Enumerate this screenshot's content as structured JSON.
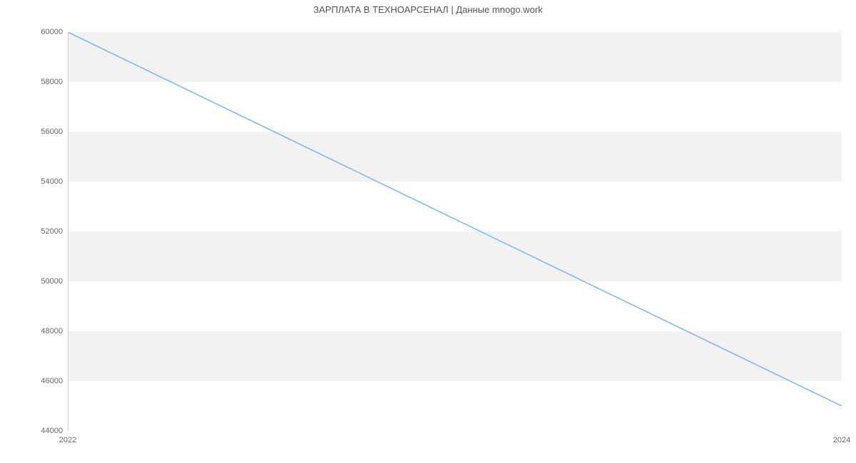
{
  "chart_data": {
    "type": "line",
    "title": "ЗАРПЛАТА В ТЕХНОАРСЕНАЛ | Данные mnogo.work",
    "xlabel": "",
    "ylabel": "",
    "x": [
      2022,
      2024
    ],
    "values": [
      60000,
      45000
    ],
    "x_ticks": [
      2022,
      2024
    ],
    "y_ticks": [
      44000,
      46000,
      48000,
      50000,
      52000,
      54000,
      56000,
      58000,
      60000
    ],
    "xlim": [
      2022,
      2024
    ],
    "ylim": [
      44000,
      60000
    ],
    "line_color": "#7cb5ec"
  }
}
